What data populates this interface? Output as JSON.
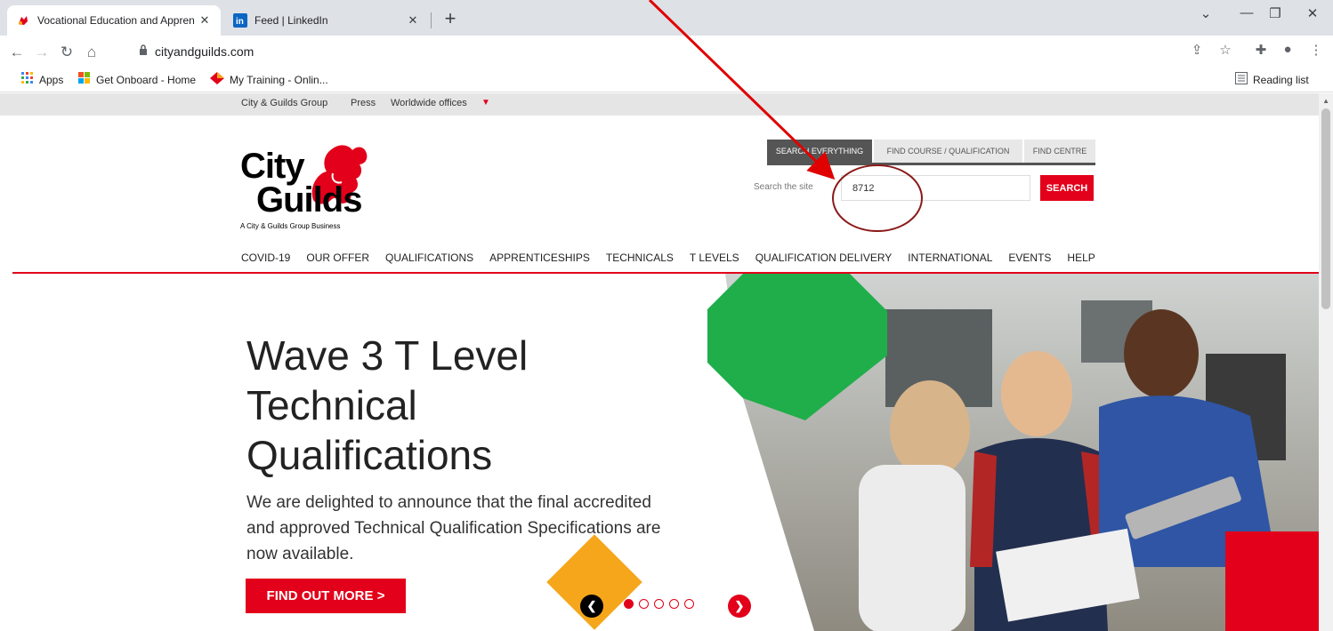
{
  "browser": {
    "tabs": [
      {
        "title": "Vocational Education and Appren",
        "active": true,
        "icon": "city-guilds-favicon-icon"
      },
      {
        "title": "Feed | LinkedIn",
        "active": false,
        "icon": "linkedin-icon"
      }
    ],
    "url": "cityandguilds.com",
    "bookmarks": [
      {
        "label": "Apps",
        "icon": "apps-grid-icon"
      },
      {
        "label": "Get Onboard - Home",
        "icon": "windows-logo-icon"
      },
      {
        "label": "My Training - Onlin...",
        "icon": "diamond-logo-icon"
      }
    ],
    "reading_list": "Reading list"
  },
  "top_links": [
    "City & Guilds Group",
    "Press",
    "Worldwide offices"
  ],
  "logo": {
    "line1": "City",
    "line2": "Guilds",
    "sub": "A City & Guilds Group Business"
  },
  "search": {
    "tabs": [
      "SEARCH EVERYTHING",
      "FIND COURSE / QUALIFICATION",
      "FIND CENTRE"
    ],
    "label": "Search the site",
    "value": "8712",
    "button": "SEARCH"
  },
  "nav": [
    "COVID-19",
    "OUR OFFER",
    "QUALIFICATIONS",
    "APPRENTICESHIPS",
    "TECHNICALS",
    "T LEVELS",
    "QUALIFICATION DELIVERY",
    "INTERNATIONAL",
    "EVENTS",
    "HELP"
  ],
  "hero": {
    "title": "Wave 3 T Level Technical Qualifications",
    "text": "We are delighted to announce that the final accredited and approved Technical Qualification Specifications are now available.",
    "button": "FIND OUT MORE >",
    "slides": 5,
    "active_slide": 1
  },
  "colors": {
    "brand_red": "#e2001a",
    "accent_orange": "#f5a61a",
    "accent_green": "#1fae4a",
    "annotation_red": "#e00000",
    "annotation_circle": "#8b1a1a"
  }
}
